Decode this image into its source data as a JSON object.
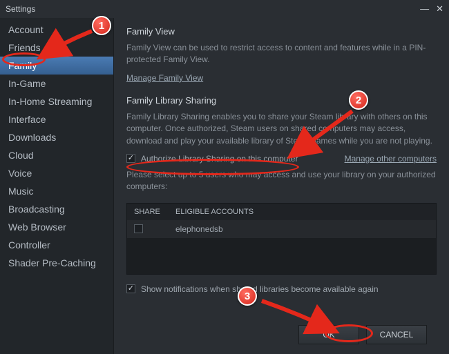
{
  "window": {
    "title": "Settings"
  },
  "sidebar": {
    "items": [
      {
        "label": "Account"
      },
      {
        "label": "Friends"
      },
      {
        "label": "Family"
      },
      {
        "label": "In-Game"
      },
      {
        "label": "In-Home Streaming"
      },
      {
        "label": "Interface"
      },
      {
        "label": "Downloads"
      },
      {
        "label": "Cloud"
      },
      {
        "label": "Voice"
      },
      {
        "label": "Music"
      },
      {
        "label": "Broadcasting"
      },
      {
        "label": "Web Browser"
      },
      {
        "label": "Controller"
      },
      {
        "label": "Shader Pre-Caching"
      }
    ],
    "selected_index": 2
  },
  "family_view": {
    "title": "Family View",
    "description": "Family View can be used to restrict access to content and features while in a PIN-protected Family View.",
    "manage_link": "Manage Family View"
  },
  "library_sharing": {
    "title": "Family Library Sharing",
    "description": "Family Library Sharing enables you to share your Steam library with others on this computer. Once authorized, Steam users on shared computers may access, download and play your available library of Steam games while you are not playing.",
    "authorize_label": "Authorize Library Sharing on this computer",
    "authorize_checked": true,
    "manage_link": "Manage other computers",
    "select_text": "Please select up to 5 users who may access and use your library on your authorized computers:",
    "table": {
      "headers": {
        "share": "SHARE",
        "account": "ELIGIBLE ACCOUNTS"
      },
      "rows": [
        {
          "checked": false,
          "account": "elephonedsb"
        }
      ]
    },
    "show_notifications_label": "Show notifications when shared libraries become available again",
    "show_notifications_checked": true
  },
  "buttons": {
    "ok": "OK",
    "cancel": "CANCEL"
  },
  "annotations": {
    "b1": "1",
    "b2": "2",
    "b3": "3"
  }
}
